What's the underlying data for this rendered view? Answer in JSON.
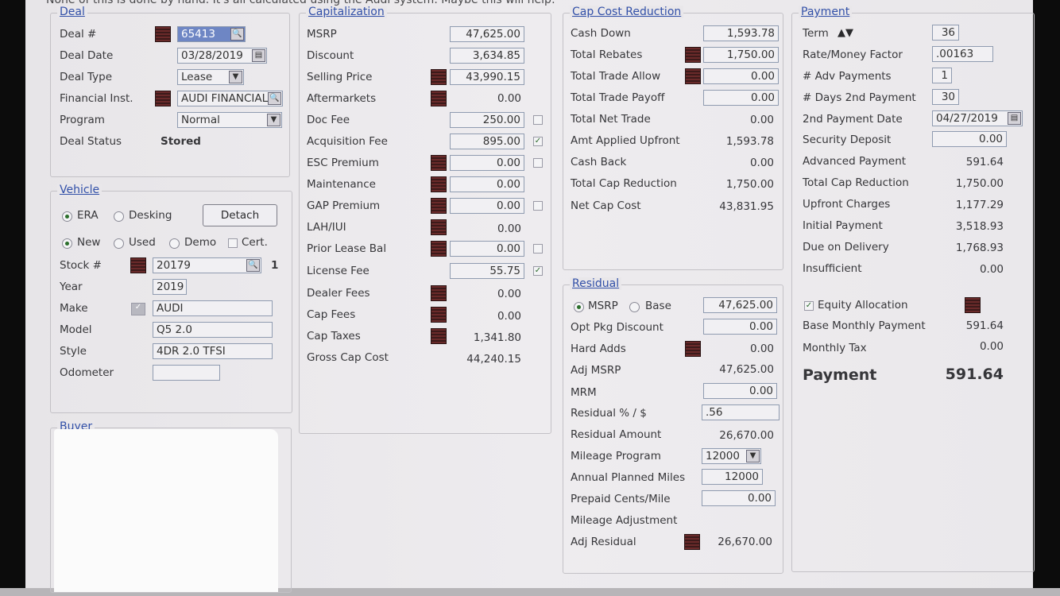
{
  "top_text": "None of this is done by hand. It's all calculated using the Audi system. Maybe this will help:",
  "deal": {
    "title": "Deal",
    "deal_no_label": "Deal #",
    "deal_no": "65413",
    "deal_date_label": "Deal Date",
    "deal_date": "03/28/2019",
    "deal_type_label": "Deal Type",
    "deal_type": "Lease",
    "fin_inst_label": "Financial Inst.",
    "fin_inst": "AUDI FINANCIAL",
    "program_label": "Program",
    "program": "Normal",
    "status_label": "Deal Status",
    "status": "Stored"
  },
  "vehicle": {
    "title": "Vehicle",
    "era": "ERA",
    "desking": "Desking",
    "detach": "Detach",
    "new": "New",
    "used": "Used",
    "demo": "Demo",
    "cert": "Cert.",
    "stock_label": "Stock #",
    "stock": "20179",
    "stock_count": "1",
    "year_label": "Year",
    "year": "2019",
    "make_label": "Make",
    "make": "AUDI",
    "model_label": "Model",
    "model": "Q5 2.0",
    "style_label": "Style",
    "style": "4DR 2.0 TFSI",
    "odometer_label": "Odometer",
    "odometer": ""
  },
  "buyer": {
    "title": "Buyer"
  },
  "cap": {
    "title": "Capitalization",
    "msrp_label": "MSRP",
    "msrp": "47,625.00",
    "discount_label": "Discount",
    "discount": "3,634.85",
    "selling_label": "Selling Price",
    "selling": "43,990.15",
    "after_label": "Aftermarkets",
    "after": "0.00",
    "docfee_label": "Doc Fee",
    "docfee": "250.00",
    "acq_label": "Acquisition Fee",
    "acq": "895.00",
    "esc_label": "ESC Premium",
    "esc": "0.00",
    "maint_label": "Maintenance",
    "maint": "0.00",
    "gap_label": "GAP Premium",
    "gap": "0.00",
    "lah_label": "LAH/IUI",
    "lah": "0.00",
    "prior_label": "Prior Lease Bal",
    "prior": "0.00",
    "license_label": "License Fee",
    "license": "55.75",
    "dealer_label": "Dealer Fees",
    "dealer": "0.00",
    "capfees_label": "Cap Fees",
    "capfees": "0.00",
    "captax_label": "Cap Taxes",
    "captax": "1,341.80",
    "gross_label": "Gross Cap Cost",
    "gross": "44,240.15"
  },
  "ccr": {
    "title": "Cap Cost Reduction",
    "cash_label": "Cash Down",
    "cash": "1,593.78",
    "rebates_label": "Total Rebates",
    "rebates": "1,750.00",
    "trade_allow_label": "Total Trade Allow",
    "trade_allow": "0.00",
    "trade_payoff_label": "Total Trade Payoff",
    "trade_payoff": "0.00",
    "net_trade_label": "Total Net Trade",
    "net_trade": "0.00",
    "applied_label": "Amt Applied Upfront",
    "applied": "1,593.78",
    "cashback_label": "Cash Back",
    "cashback": "0.00",
    "total_red_label": "Total Cap Reduction",
    "total_red": "1,750.00",
    "netcap_label": "Net Cap Cost",
    "netcap": "43,831.95"
  },
  "residual": {
    "title": "Residual",
    "msrp": "MSRP",
    "base": "Base",
    "msrp_val": "47,625.00",
    "optpkg_label": "Opt Pkg Discount",
    "optpkg": "0.00",
    "hard_label": "Hard Adds",
    "hard": "0.00",
    "adjmsrp_label": "Adj MSRP",
    "adjmsrp": "47,625.00",
    "mrm_label": "MRM",
    "mrm": "0.00",
    "pct_label": "Residual % / $",
    "pct": ".56",
    "amount_label": "Residual Amount",
    "amount": "26,670.00",
    "mileage_label": "Mileage Program",
    "mileage": "12000",
    "annual_label": "Annual Planned Miles",
    "annual": "12000",
    "prepaid_label": "Prepaid Cents/Mile",
    "prepaid": "0.00",
    "madj_label": "Mileage Adjustment",
    "adjres_label": "Adj Residual",
    "adjres": "26,670.00"
  },
  "payment": {
    "title": "Payment",
    "term_label": "Term",
    "term": "36",
    "rate_label": "Rate/Money Factor",
    "rate": ".00163",
    "adv_label": "# Adv Payments",
    "adv": "1",
    "days2_label": "# Days 2nd Payment",
    "days2": "30",
    "date2_label": "2nd Payment Date",
    "date2": "04/27/2019",
    "secdep_label": "Security Deposit",
    "secdep": "0.00",
    "advpay_label": "Advanced Payment",
    "advpay": "591.64",
    "tcr_label": "Total Cap Reduction",
    "tcr": "1,750.00",
    "upfront_label": "Upfront Charges",
    "upfront": "1,177.29",
    "initial_label": "Initial Payment",
    "initial": "3,518.93",
    "due_label": "Due on Delivery",
    "due": "1,768.93",
    "insuff_label": "Insufficient",
    "insuff": "0.00",
    "equity_label": "Equity Allocation",
    "base_label": "Base Monthly Payment",
    "base": "591.64",
    "tax_label": "Monthly Tax",
    "tax": "0.00",
    "pay_label": "Payment",
    "pay": "591.64"
  }
}
